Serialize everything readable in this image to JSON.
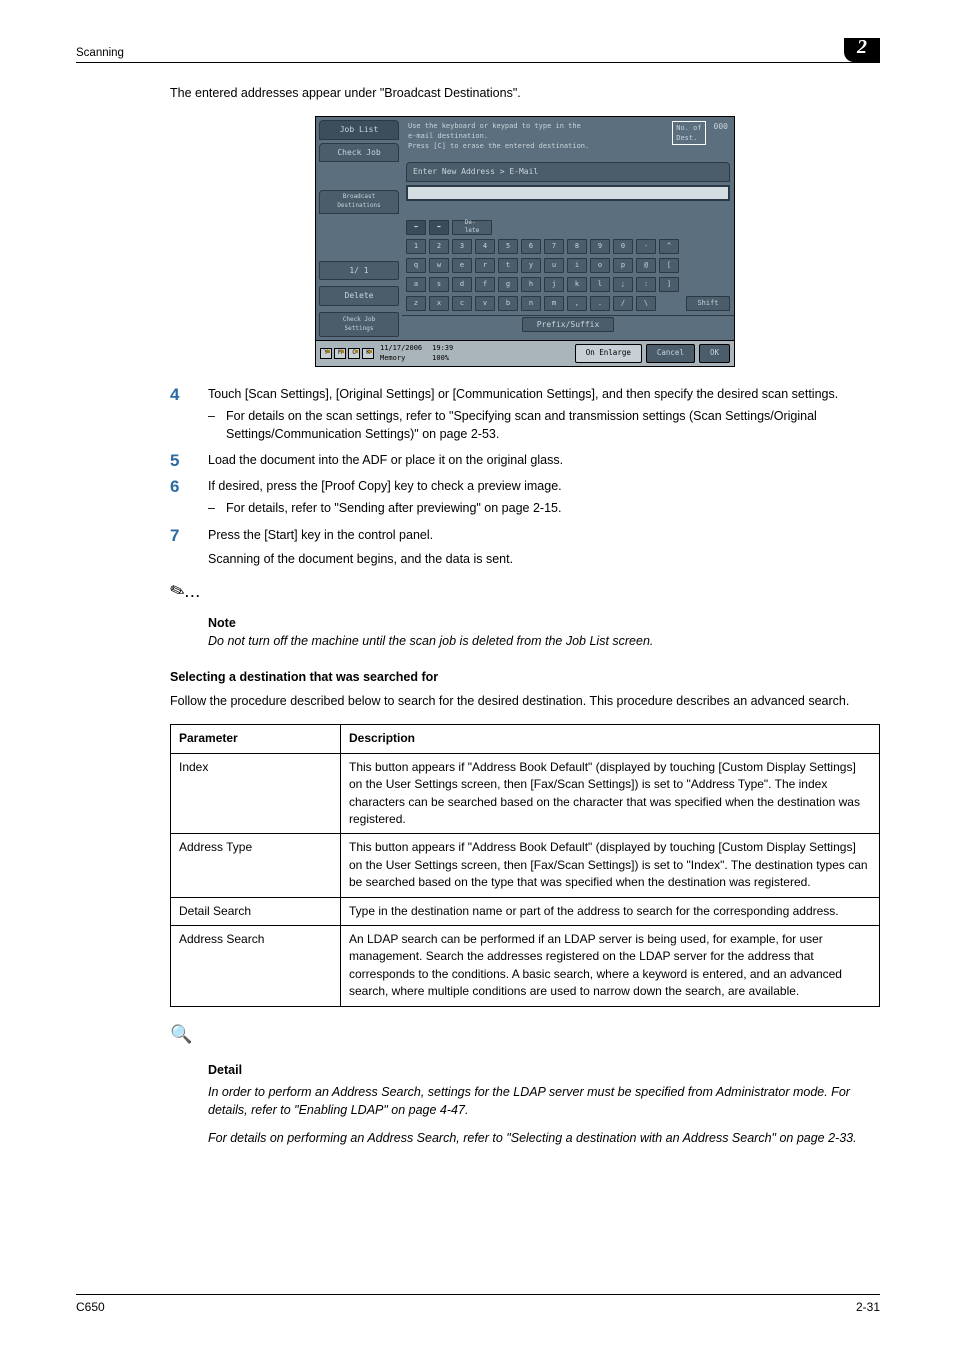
{
  "header": {
    "title": "Scanning",
    "chapter": "2"
  },
  "intro": "The entered addresses appear under \"Broadcast Destinations\".",
  "screenshot": {
    "tabs": {
      "job_list": "Job List",
      "check_job": "Check Job"
    },
    "instr_l1": "Use the keyboard or keypad to type in the",
    "instr_l2": "e-mail destination.",
    "instr_l3": "Press [C] to erase the entered destination.",
    "dest_label": "No. of\nDest.",
    "dest_count": "000",
    "enter": "Enter New Address > E-Mail",
    "bd_label": "Broadcast\nDestinations",
    "page_ind": "1/  1",
    "delete_btn": "Delete",
    "check_settings": "Check Job\nSettings",
    "del_key": "De-\nlete",
    "row_num": [
      "1",
      "2",
      "3",
      "4",
      "5",
      "6",
      "7",
      "8",
      "9",
      "0",
      "-",
      "^"
    ],
    "row_q": [
      "q",
      "w",
      "e",
      "r",
      "t",
      "y",
      "u",
      "i",
      "o",
      "p",
      "@",
      "["
    ],
    "row_a": [
      "a",
      "s",
      "d",
      "f",
      "g",
      "h",
      "j",
      "k",
      "l",
      ";",
      ":",
      "]"
    ],
    "row_z": [
      "z",
      "x",
      "c",
      "v",
      "b",
      "n",
      "m",
      ",",
      ".",
      "/",
      "\\"
    ],
    "shift": "Shift",
    "prefix_suffix": "Prefix/Suffix",
    "status": {
      "ind": [
        "Y",
        "M",
        "C",
        "K"
      ],
      "date": "11/17/2006",
      "time": "19:39",
      "mem_l": "Memory",
      "mem_v": "100%",
      "enlarge": "On Enlarge",
      "cancel": "Cancel",
      "ok": "OK"
    }
  },
  "steps": [
    {
      "n": "4",
      "text": "Touch [Scan Settings], [Original Settings] or [Communication Settings], and then specify the desired scan settings.",
      "bullets": [
        "For details on the scan settings, refer to \"Specifying scan and transmission settings (Scan Settings/Original Settings/Communication Settings)\" on page 2-53."
      ]
    },
    {
      "n": "5",
      "text": "Load the document into the ADF or place it on the original glass.",
      "bullets": []
    },
    {
      "n": "6",
      "text": "If desired, press the [Proof Copy] key to check a preview image.",
      "bullets": [
        "For details, refer to \"Sending after previewing\" on page 2-15."
      ]
    },
    {
      "n": "7",
      "text": "Press the [Start] key in the control panel.",
      "bullets": [],
      "after": "Scanning of the document begins, and the data is sent."
    }
  ],
  "note": {
    "label": "Note",
    "text": "Do not turn off the machine until the scan job is deleted from the Job List screen."
  },
  "section2": {
    "title": "Selecting a destination that was searched for",
    "intro": "Follow the procedure described below to search for the desired destination. This procedure describes an advanced search."
  },
  "table": {
    "head": [
      "Parameter",
      "Description"
    ],
    "rows": [
      [
        "Index",
        "This button appears if \"Address Book Default\" (displayed by touching [Custom Display Settings] on the User Settings screen, then [Fax/Scan Settings]) is set to \"Address Type\". The index characters can be searched based on the character that was specified when the destination was registered."
      ],
      [
        "Address Type",
        "This button appears if \"Address Book Default\" (displayed by touching [Custom Display Settings] on the User Settings screen, then [Fax/Scan Settings]) is set to \"Index\". The destination types can be searched based on the type that was specified when the destination was registered."
      ],
      [
        "Detail Search",
        "Type in the destination name or part of the address to search for the corresponding address."
      ],
      [
        "Address Search",
        "An LDAP search can be performed if an LDAP server is being used, for example, for user management. Search the addresses registered on the LDAP server for the address that corresponds to the conditions. A basic search, where a keyword is entered, and an advanced search, where multiple conditions are used to narrow down the search, are available."
      ]
    ]
  },
  "detail": {
    "label": "Detail",
    "p1": "In order to perform an Address Search, settings for the LDAP server must be specified from Administrator mode. For details, refer to \"Enabling LDAP\" on page 4-47.",
    "p2": "For details on performing an Address Search, refer to \"Selecting a destination with an Address Search\" on page 2-33."
  },
  "footer": {
    "left": "C650",
    "right": "2-31"
  }
}
